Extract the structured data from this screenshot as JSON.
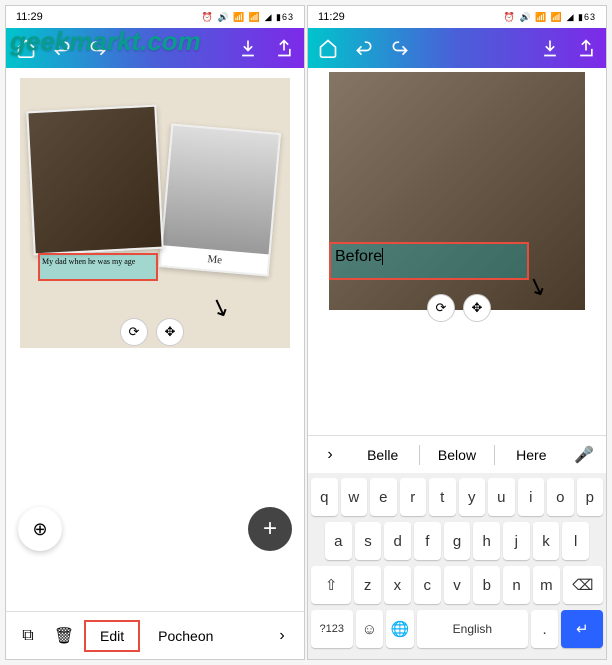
{
  "watermark": "geekmarkt.com",
  "statusbar": {
    "time": "11:29",
    "indicators": "⏰ 🔊 📶 📶 ◢ ▮63"
  },
  "left_screen": {
    "design": {
      "left_polaroid": {
        "caption": "My dad when he was my age"
      },
      "right_polaroid": {
        "caption": "Me"
      }
    },
    "bottombar": {
      "edit": "Edit",
      "font": "Pocheon"
    }
  },
  "right_screen": {
    "design": {
      "text_input": "Before"
    },
    "suggestions": {
      "s1": "Belle",
      "s2": "Below",
      "s3": "Here"
    },
    "keyboard": {
      "row1": [
        "q",
        "w",
        "e",
        "r",
        "t",
        "y",
        "u",
        "i",
        "o",
        "p"
      ],
      "row2": [
        "a",
        "s",
        "d",
        "f",
        "g",
        "h",
        "j",
        "k",
        "l"
      ],
      "row3_shift": "⇧",
      "row3": [
        "z",
        "x",
        "c",
        "v",
        "b",
        "n",
        "m"
      ],
      "row3_back": "⌫",
      "row4": {
        "num": "?123",
        "emoji": "☺",
        "globe": "🌐",
        "space": "English",
        "period": ".",
        "enter": "↵"
      }
    }
  }
}
